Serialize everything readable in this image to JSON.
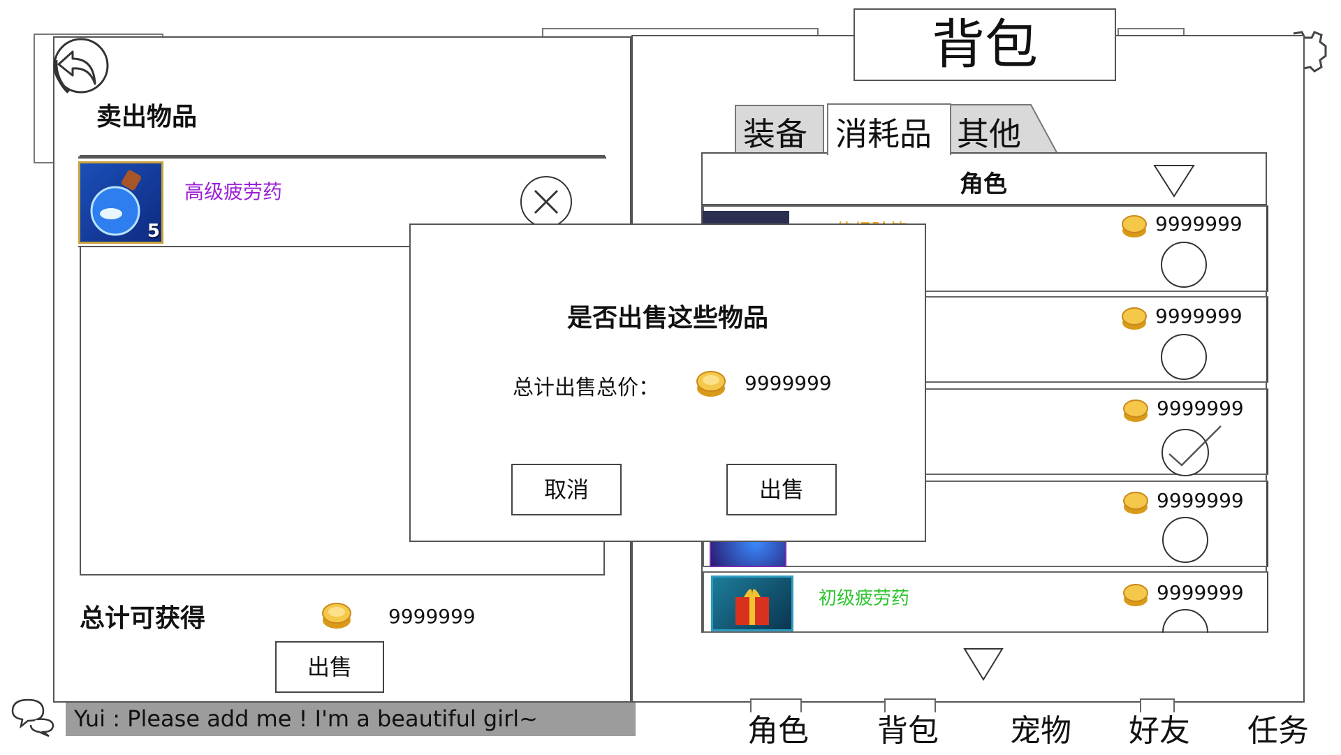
{
  "colors": {
    "rare_item_name": "#9b1fd6",
    "orange_item_name": "#f0a000",
    "green_item_name": "#2ec52e",
    "chat_bar_bg": "#9c9c9c",
    "coin": "#f2c230"
  },
  "header": {
    "title": "背包"
  },
  "tabs": [
    {
      "label": "装备"
    },
    {
      "label": "消耗品"
    },
    {
      "label": "其他"
    }
  ],
  "filter": {
    "label": "角色",
    "icon": "triangle-down-icon"
  },
  "inventory": {
    "items": [
      {
        "name": "二倍经验符",
        "price": "9999999",
        "selected": false
      },
      {
        "name": "",
        "price": "9999999",
        "selected": false
      },
      {
        "name": "",
        "price": "9999999",
        "selected": true
      },
      {
        "name": "",
        "price": "9999999",
        "selected": false
      },
      {
        "name": "初级疲劳药",
        "price": "9999999",
        "selected": false
      }
    ],
    "scroll_icon": "triangle-down-icon"
  },
  "sell_panel": {
    "title": "卖出物品",
    "item": {
      "name": "高级疲劳药",
      "count": "5"
    },
    "total_label": "总计可获得",
    "total_value": "9999999",
    "sell_button": "出售"
  },
  "dialog": {
    "question": "是否出售这些物品",
    "total_label": "总计出售总价：",
    "total_value": "9999999",
    "cancel": "取消",
    "confirm": "出售"
  },
  "chat": {
    "message": "Yui : Please add me ! I'm a beautiful girl~"
  },
  "bottom_nav": [
    {
      "label": "角色"
    },
    {
      "label": "背包"
    },
    {
      "label": "宠物"
    },
    {
      "label": "好友"
    },
    {
      "label": "任务"
    }
  ]
}
